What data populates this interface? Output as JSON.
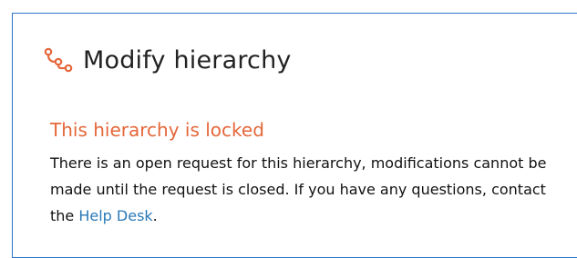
{
  "dialog": {
    "icon": "hierarchy-icon",
    "title": "Modify hierarchy",
    "accent_color": "#e5673a",
    "border_color": "#2b73c9"
  },
  "notice": {
    "heading": "This hierarchy is locked",
    "message_before": "There is an open request for this hierarchy, modifications cannot be made until the request is closed. If you have any questions, contact the ",
    "link_text": "Help Desk",
    "message_after": "."
  }
}
